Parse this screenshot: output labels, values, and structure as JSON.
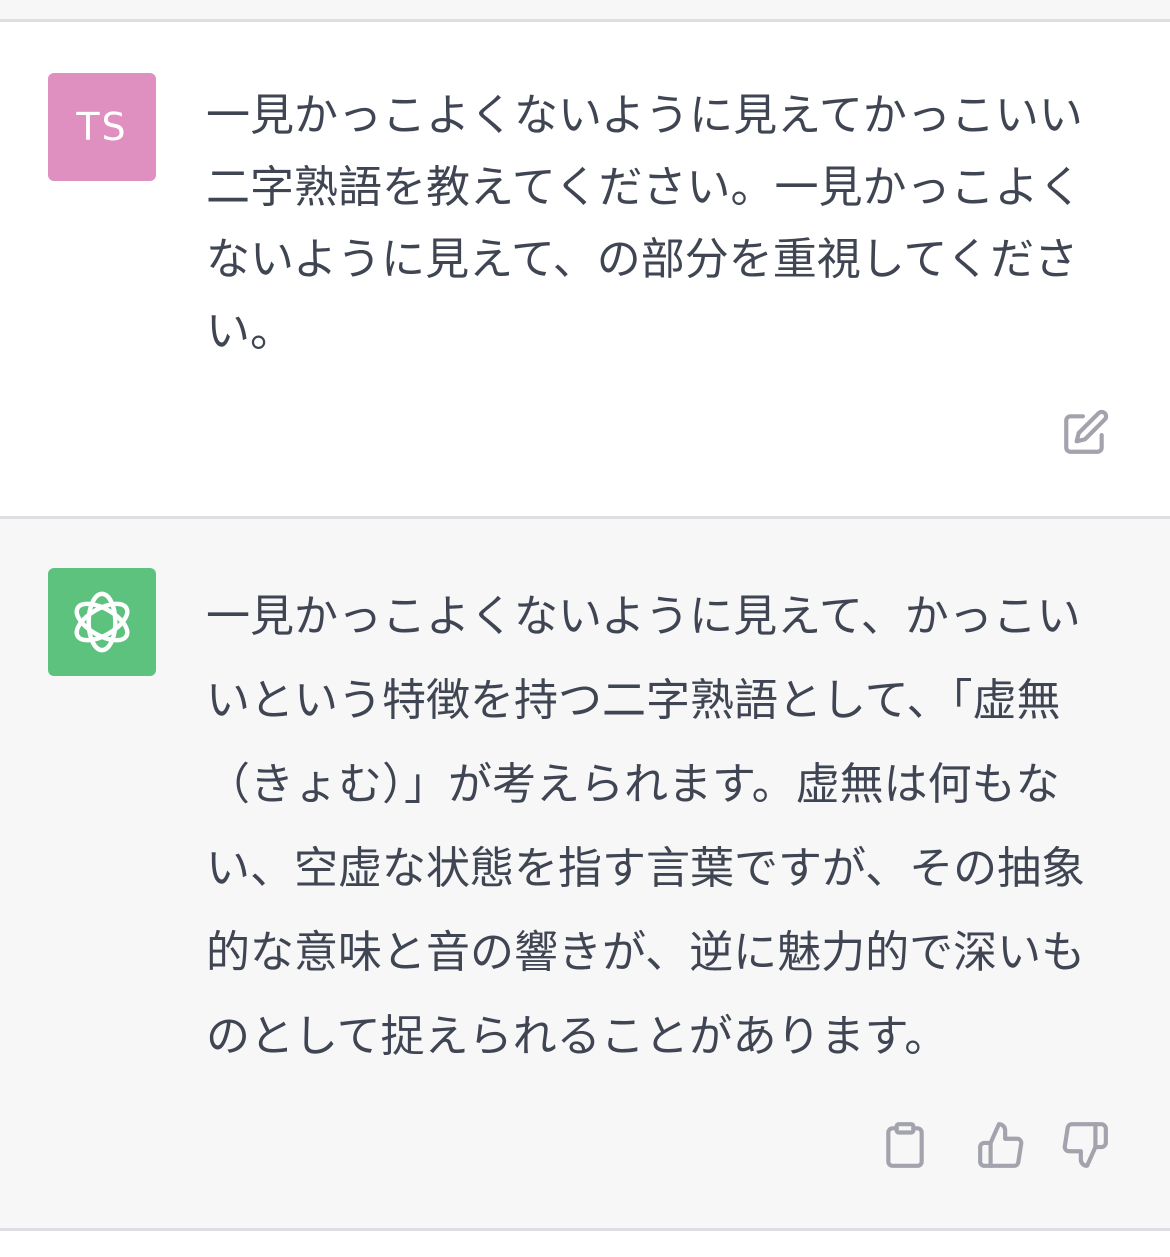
{
  "conversation": {
    "user_message": {
      "avatar_initials": "TS",
      "avatar_color": "#e090c0",
      "text": "一見かっこよくないように見えてかっこいい二字熟語を教えてください。一見かっこよくないように見えて、の部分を重視してください。",
      "actions": [
        "edit-icon"
      ]
    },
    "assistant_message": {
      "avatar_icon": "openai-logo-icon",
      "avatar_color": "#5ec27f",
      "text": "一見かっこよくないように見えて、かっこいいという特徴を持つ二字熟語として、「虚無（きょむ）」が考えられます。虚無は何もない、空虚な状態を指す言葉ですが、その抽象的な意味と音の響きが、逆に魅力的で深いものとして捉えられることがあります。",
      "actions": [
        "clipboard-icon",
        "thumbs-up-icon",
        "thumbs-down-icon"
      ]
    }
  }
}
